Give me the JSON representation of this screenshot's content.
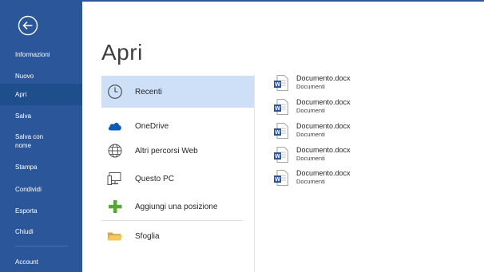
{
  "sidebar": {
    "items": [
      {
        "label": "Informazioni"
      },
      {
        "label": "Nuovo"
      },
      {
        "label": "Apri"
      },
      {
        "label": "Salva"
      },
      {
        "label": "Salva con\nnome"
      },
      {
        "label": "Stampa"
      },
      {
        "label": "Condividi"
      },
      {
        "label": "Esporta"
      },
      {
        "label": "Chiudi"
      },
      {
        "label": "Account"
      }
    ],
    "active_item": "Apri"
  },
  "main": {
    "title": "Apri",
    "places": [
      {
        "label": "Recenti",
        "icon": "clock-icon",
        "selected": true
      },
      {
        "label": "OneDrive",
        "icon": "cloud-icon"
      },
      {
        "label": "Altri percorsi Web",
        "icon": "globe-icon"
      },
      {
        "label": "Questo PC",
        "icon": "computer-icon"
      },
      {
        "label": "Aggiungi una posizione",
        "icon": "plus-icon"
      },
      {
        "label": "Sfoglia",
        "icon": "folder-icon"
      }
    ],
    "recent_files": [
      {
        "name": "Documento.docx",
        "location": "Documenti"
      },
      {
        "name": "Documento.docx",
        "location": "Documenti"
      },
      {
        "name": "Documento.docx",
        "location": "Documenti"
      },
      {
        "name": "Documento.docx",
        "location": "Documenti"
      },
      {
        "name": "Documento.docx",
        "location": "Documenti"
      }
    ]
  },
  "colors": {
    "sidebar": "#2b579a",
    "sidebar_active": "#1e4e8c",
    "selected_place": "#cde0f7",
    "word_blue": "#2b579a"
  }
}
